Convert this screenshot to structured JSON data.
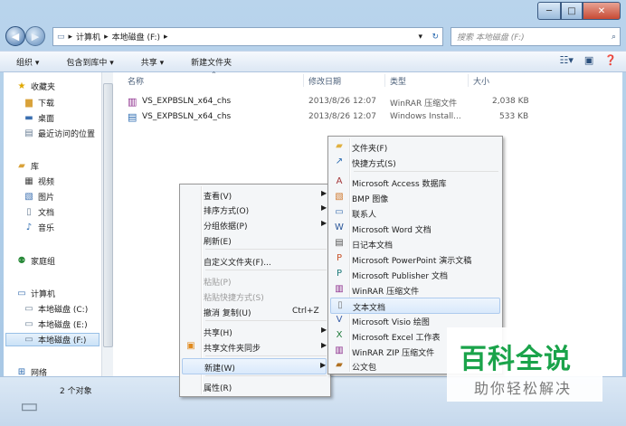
{
  "window": {
    "min": "─",
    "max": "□",
    "close": "✕"
  },
  "address": {
    "path": [
      "计算机",
      "本地磁盘 (F:)"
    ],
    "search_placeholder": "搜索 本地磁盘 (F:)"
  },
  "toolbar": {
    "organize": "组织 ▾",
    "include_library": "包含到库中 ▾",
    "share": "共享 ▾",
    "new_folder": "新建文件夹"
  },
  "nav": [
    {
      "label": "收藏夹",
      "icon": "star-icon"
    },
    {
      "label": "下载",
      "icon": "download-folder-icon"
    },
    {
      "label": "桌面",
      "icon": "desktop-icon"
    },
    {
      "label": "最近访问的位置",
      "icon": "recent-places-icon"
    },
    {
      "label": "库",
      "icon": "library-icon"
    },
    {
      "label": "视频",
      "icon": "video-icon"
    },
    {
      "label": "图片",
      "icon": "picture-icon"
    },
    {
      "label": "文档",
      "icon": "document-icon"
    },
    {
      "label": "音乐",
      "icon": "music-icon"
    },
    {
      "label": "家庭组",
      "icon": "homegroup-icon"
    },
    {
      "label": "计算机",
      "icon": "computer-icon"
    },
    {
      "label": "本地磁盘 (C:)",
      "icon": "drive-icon"
    },
    {
      "label": "本地磁盘 (E:)",
      "icon": "drive-icon"
    },
    {
      "label": "本地磁盘 (F:)",
      "icon": "drive-icon"
    },
    {
      "label": "网络",
      "icon": "network-icon"
    }
  ],
  "columns": {
    "name": "名称",
    "date": "修改日期",
    "type": "类型",
    "size": "大小"
  },
  "files": [
    {
      "name": "VS_EXPBSLN_x64_chs",
      "date": "2013/8/26 12:07",
      "type": "WinRAR 压缩文件",
      "size": "2,038 KB"
    },
    {
      "name": "VS_EXPBSLN_x64_chs",
      "date": "2013/8/26 12:07",
      "type": "Windows Install...",
      "size": "533 KB"
    }
  ],
  "status": {
    "count": "2 个对象"
  },
  "context_menu": {
    "view": "查看(V)",
    "sort": "排序方式(O)",
    "group": "分组依据(P)",
    "refresh": "刷新(E)",
    "customize": "自定义文件夹(F)...",
    "paste": "粘贴(P)",
    "paste_shortcut": "粘贴快捷方式(S)",
    "undo": "撤消 复制(U)",
    "undo_shortcut": "Ctrl+Z",
    "share": "共享(H)",
    "sync": "共享文件夹同步",
    "new": "新建(W)",
    "properties": "属性(R)"
  },
  "new_menu": [
    "文件夹(F)",
    "快捷方式(S)",
    "Microsoft Access 数据库",
    "BMP 图像",
    "联系人",
    "Microsoft Word 文档",
    "日记本文档",
    "Microsoft PowerPoint 演示文稿",
    "Microsoft Publisher 文档",
    "WinRAR 压缩文件",
    "文本文档",
    "Microsoft Visio 绘图",
    "Microsoft Excel 工作表",
    "WinRAR ZIP 压缩文件",
    "公文包"
  ],
  "watermark": {
    "title": "百科全说",
    "subtitle": "助你轻松解决"
  },
  "colors": {
    "accent": "#1aa34a",
    "highlight": "#d9e9fb"
  }
}
